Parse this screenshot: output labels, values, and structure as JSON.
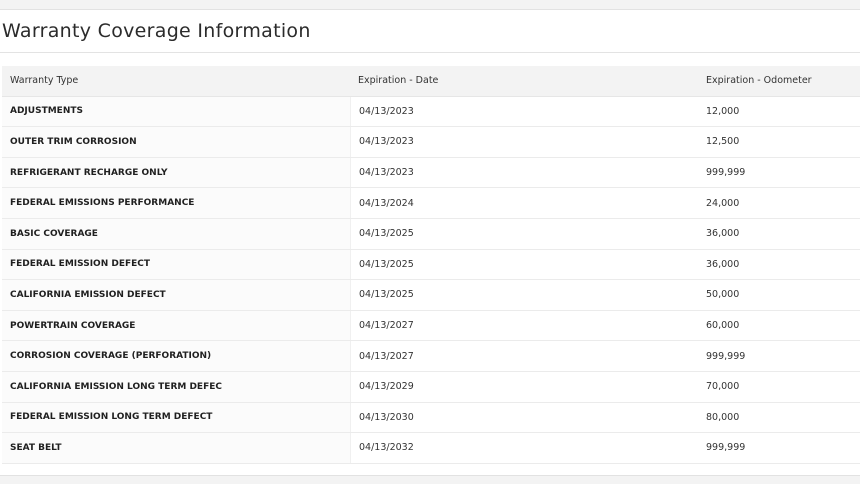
{
  "page": {
    "title": "Warranty Coverage Information"
  },
  "table": {
    "headers": [
      "Warranty Type",
      "Expiration - Date",
      "Expiration - Odometer"
    ],
    "rows": [
      {
        "type": "ADJUSTMENTS",
        "date": "04/13/2023",
        "odometer": "12,000"
      },
      {
        "type": "OUTER TRIM CORROSION",
        "date": "04/13/2023",
        "odometer": "12,500"
      },
      {
        "type": "REFRIGERANT RECHARGE ONLY",
        "date": "04/13/2023",
        "odometer": "999,999"
      },
      {
        "type": "FEDERAL EMISSIONS PERFORMANCE",
        "date": "04/13/2024",
        "odometer": "24,000"
      },
      {
        "type": "BASIC COVERAGE",
        "date": "04/13/2025",
        "odometer": "36,000"
      },
      {
        "type": "FEDERAL EMISSION DEFECT",
        "date": "04/13/2025",
        "odometer": "36,000"
      },
      {
        "type": "CALIFORNIA EMISSION DEFECT",
        "date": "04/13/2025",
        "odometer": "50,000"
      },
      {
        "type": "POWERTRAIN COVERAGE",
        "date": "04/13/2027",
        "odometer": "60,000"
      },
      {
        "type": "CORROSION COVERAGE (PERFORATION)",
        "date": "04/13/2027",
        "odometer": "999,999"
      },
      {
        "type": "CALIFORNIA EMISSION LONG TERM DEFEC",
        "date": "04/13/2029",
        "odometer": "70,000"
      },
      {
        "type": "FEDERAL EMISSION LONG TERM DEFECT",
        "date": "04/13/2030",
        "odometer": "80,000"
      },
      {
        "type": "SEAT BELT",
        "date": "04/13/2032",
        "odometer": "999,999"
      }
    ]
  }
}
